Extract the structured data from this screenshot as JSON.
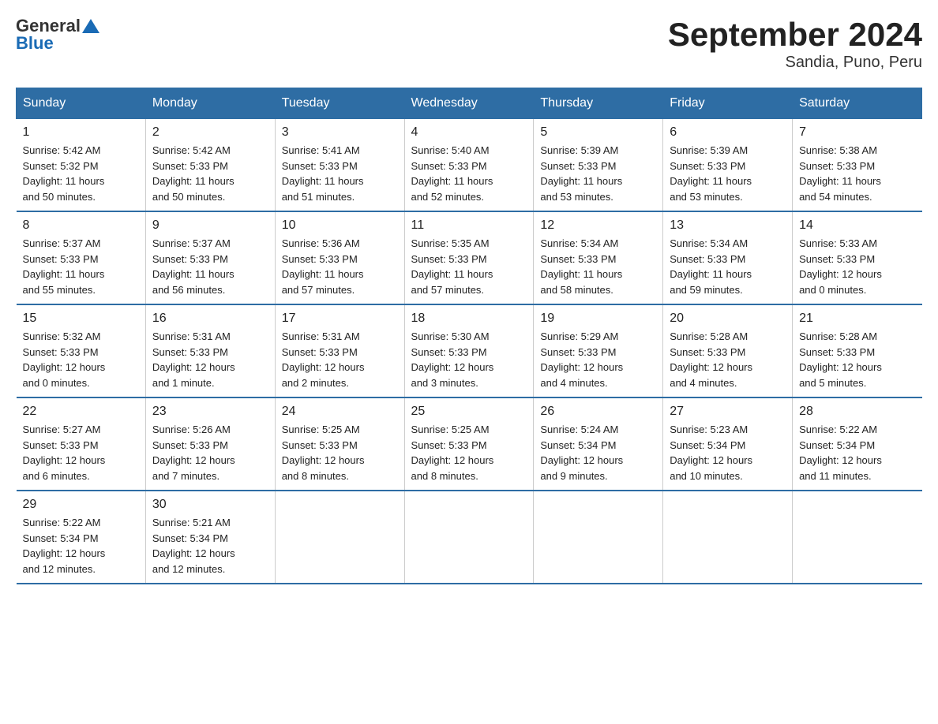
{
  "header": {
    "logo_text_general": "General",
    "logo_text_blue": "Blue",
    "title": "September 2024",
    "subtitle": "Sandia, Puno, Peru"
  },
  "days_of_week": [
    "Sunday",
    "Monday",
    "Tuesday",
    "Wednesday",
    "Thursday",
    "Friday",
    "Saturday"
  ],
  "weeks": [
    [
      {
        "day": "1",
        "info": "Sunrise: 5:42 AM\nSunset: 5:32 PM\nDaylight: 11 hours\nand 50 minutes."
      },
      {
        "day": "2",
        "info": "Sunrise: 5:42 AM\nSunset: 5:33 PM\nDaylight: 11 hours\nand 50 minutes."
      },
      {
        "day": "3",
        "info": "Sunrise: 5:41 AM\nSunset: 5:33 PM\nDaylight: 11 hours\nand 51 minutes."
      },
      {
        "day": "4",
        "info": "Sunrise: 5:40 AM\nSunset: 5:33 PM\nDaylight: 11 hours\nand 52 minutes."
      },
      {
        "day": "5",
        "info": "Sunrise: 5:39 AM\nSunset: 5:33 PM\nDaylight: 11 hours\nand 53 minutes."
      },
      {
        "day": "6",
        "info": "Sunrise: 5:39 AM\nSunset: 5:33 PM\nDaylight: 11 hours\nand 53 minutes."
      },
      {
        "day": "7",
        "info": "Sunrise: 5:38 AM\nSunset: 5:33 PM\nDaylight: 11 hours\nand 54 minutes."
      }
    ],
    [
      {
        "day": "8",
        "info": "Sunrise: 5:37 AM\nSunset: 5:33 PM\nDaylight: 11 hours\nand 55 minutes."
      },
      {
        "day": "9",
        "info": "Sunrise: 5:37 AM\nSunset: 5:33 PM\nDaylight: 11 hours\nand 56 minutes."
      },
      {
        "day": "10",
        "info": "Sunrise: 5:36 AM\nSunset: 5:33 PM\nDaylight: 11 hours\nand 57 minutes."
      },
      {
        "day": "11",
        "info": "Sunrise: 5:35 AM\nSunset: 5:33 PM\nDaylight: 11 hours\nand 57 minutes."
      },
      {
        "day": "12",
        "info": "Sunrise: 5:34 AM\nSunset: 5:33 PM\nDaylight: 11 hours\nand 58 minutes."
      },
      {
        "day": "13",
        "info": "Sunrise: 5:34 AM\nSunset: 5:33 PM\nDaylight: 11 hours\nand 59 minutes."
      },
      {
        "day": "14",
        "info": "Sunrise: 5:33 AM\nSunset: 5:33 PM\nDaylight: 12 hours\nand 0 minutes."
      }
    ],
    [
      {
        "day": "15",
        "info": "Sunrise: 5:32 AM\nSunset: 5:33 PM\nDaylight: 12 hours\nand 0 minutes."
      },
      {
        "day": "16",
        "info": "Sunrise: 5:31 AM\nSunset: 5:33 PM\nDaylight: 12 hours\nand 1 minute."
      },
      {
        "day": "17",
        "info": "Sunrise: 5:31 AM\nSunset: 5:33 PM\nDaylight: 12 hours\nand 2 minutes."
      },
      {
        "day": "18",
        "info": "Sunrise: 5:30 AM\nSunset: 5:33 PM\nDaylight: 12 hours\nand 3 minutes."
      },
      {
        "day": "19",
        "info": "Sunrise: 5:29 AM\nSunset: 5:33 PM\nDaylight: 12 hours\nand 4 minutes."
      },
      {
        "day": "20",
        "info": "Sunrise: 5:28 AM\nSunset: 5:33 PM\nDaylight: 12 hours\nand 4 minutes."
      },
      {
        "day": "21",
        "info": "Sunrise: 5:28 AM\nSunset: 5:33 PM\nDaylight: 12 hours\nand 5 minutes."
      }
    ],
    [
      {
        "day": "22",
        "info": "Sunrise: 5:27 AM\nSunset: 5:33 PM\nDaylight: 12 hours\nand 6 minutes."
      },
      {
        "day": "23",
        "info": "Sunrise: 5:26 AM\nSunset: 5:33 PM\nDaylight: 12 hours\nand 7 minutes."
      },
      {
        "day": "24",
        "info": "Sunrise: 5:25 AM\nSunset: 5:33 PM\nDaylight: 12 hours\nand 8 minutes."
      },
      {
        "day": "25",
        "info": "Sunrise: 5:25 AM\nSunset: 5:33 PM\nDaylight: 12 hours\nand 8 minutes."
      },
      {
        "day": "26",
        "info": "Sunrise: 5:24 AM\nSunset: 5:34 PM\nDaylight: 12 hours\nand 9 minutes."
      },
      {
        "day": "27",
        "info": "Sunrise: 5:23 AM\nSunset: 5:34 PM\nDaylight: 12 hours\nand 10 minutes."
      },
      {
        "day": "28",
        "info": "Sunrise: 5:22 AM\nSunset: 5:34 PM\nDaylight: 12 hours\nand 11 minutes."
      }
    ],
    [
      {
        "day": "29",
        "info": "Sunrise: 5:22 AM\nSunset: 5:34 PM\nDaylight: 12 hours\nand 12 minutes."
      },
      {
        "day": "30",
        "info": "Sunrise: 5:21 AM\nSunset: 5:34 PM\nDaylight: 12 hours\nand 12 minutes."
      },
      {
        "day": "",
        "info": ""
      },
      {
        "day": "",
        "info": ""
      },
      {
        "day": "",
        "info": ""
      },
      {
        "day": "",
        "info": ""
      },
      {
        "day": "",
        "info": ""
      }
    ]
  ]
}
